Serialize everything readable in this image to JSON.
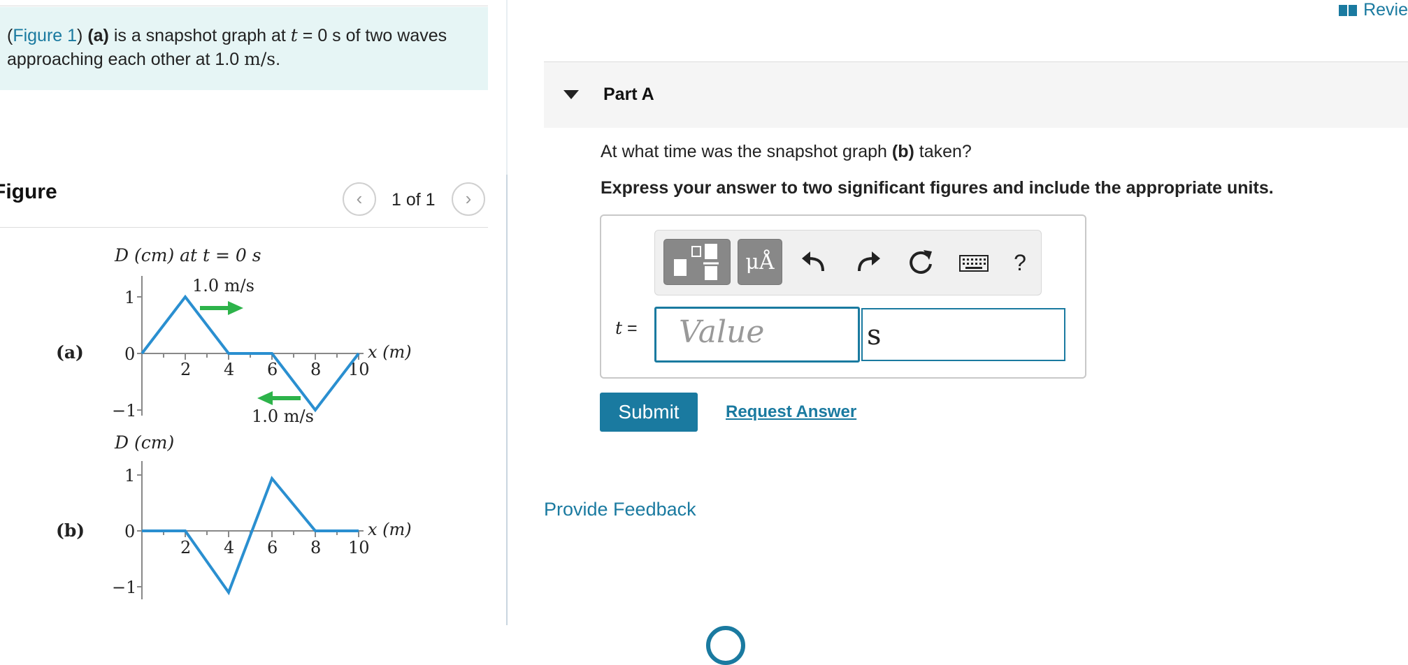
{
  "problem": {
    "figure_link": "Figure 1",
    "label_a": "(a)",
    "text_1": " is a snapshot graph at ",
    "t_var": "t",
    "text_2": " = 0 s of two waves",
    "text_3": "approaching each other at 1.0 ",
    "speed_unit": "m/s",
    "text_end": "."
  },
  "figure": {
    "title": "Figure",
    "counter": "1 of 1",
    "prev_icon": "chevron-left-icon",
    "next_icon": "chevron-right-icon",
    "graph_a": {
      "panel_label": "(a)",
      "y_axis_label": "D (cm) at t = 0 s",
      "x_axis_label": "x (m)",
      "y_ticks": [
        "1",
        "0",
        "−1"
      ],
      "x_ticks": [
        "2",
        "4",
        "6",
        "8",
        "10"
      ],
      "speed_label_top": "1.0 m/s",
      "speed_label_bottom": "1.0 m/s",
      "arrow_color": "#2db34a",
      "wave_color": "#2a8fd0"
    },
    "graph_b": {
      "panel_label": "(b)",
      "y_axis_label": "D (cm)",
      "x_axis_label": "x (m)",
      "y_ticks": [
        "1",
        "0",
        "−1"
      ],
      "x_ticks": [
        "2",
        "4",
        "6",
        "8",
        "10"
      ]
    }
  },
  "review": {
    "label": "Revie",
    "icon": "book-icon"
  },
  "part": {
    "title": "Part A",
    "caret_icon": "caret-down-icon"
  },
  "question": {
    "prefix": "At what time was the snapshot graph ",
    "bold": "(b)",
    "suffix": " taken?"
  },
  "instruction": "Express your answer to two significant figures and include the appropriate units.",
  "toolbar": {
    "units_button": "μÅ",
    "help": "?"
  },
  "answer": {
    "variable": "t",
    "equals": "=",
    "value_placeholder": "Value",
    "unit_value": "s"
  },
  "buttons": {
    "submit": "Submit",
    "request_answer": "Request Answer",
    "feedback": "Provide Feedback"
  },
  "colors": {
    "accent": "#1a7aa0",
    "problem_bg": "#e6f5f5"
  }
}
